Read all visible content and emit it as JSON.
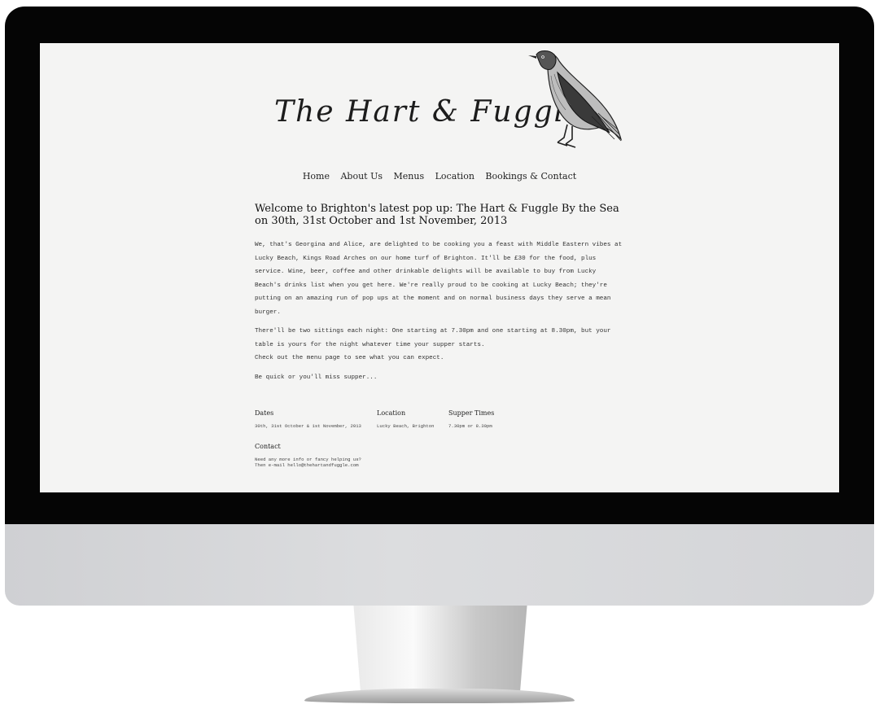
{
  "site": {
    "logo_text": "The Hart & Fuggle"
  },
  "nav": [
    "Home",
    "About Us",
    "Menus",
    "Location",
    "Bookings & Contact"
  ],
  "article": {
    "headline": "Welcome to Brighton's latest pop up: The Hart & Fuggle By the Sea on 30th, 31st October and 1st November, 2013",
    "paragraphs": [
      "We, that's Georgina and Alice, are delighted to be cooking you a feast with Middle Eastern vibes at Lucky Beach, Kings Road Arches on our home turf of Brighton. It'll be £30 for the food, plus service. Wine, beer, coffee and other drinkable delights will be available to buy from Lucky Beach's drinks list when you get here. We're really proud to be cooking at Lucky Beach; they're putting on an amazing run of pop ups at the moment and on normal business days they serve a mean burger.",
      "There'll be two sittings each night: One starting at 7.30pm and one starting at 8.30pm, but your table is yours for the night whatever time your supper starts.",
      "Check out the menu page to see what you can expect.",
      "Be quick or you'll miss supper..."
    ]
  },
  "info": {
    "dates_label": "Dates",
    "dates_value": "30th, 31st October & 1st November, 2013",
    "location_label": "Location",
    "location_value": "Lucky Beach, Brighton",
    "times_label": "Supper Times",
    "times_value": "7.30pm or 8.30pm"
  },
  "contact": {
    "label": "Contact",
    "line1": "Need any more info or fancy helping us?",
    "line2": "Then e-mail hello@thehartandfuggle.com"
  }
}
